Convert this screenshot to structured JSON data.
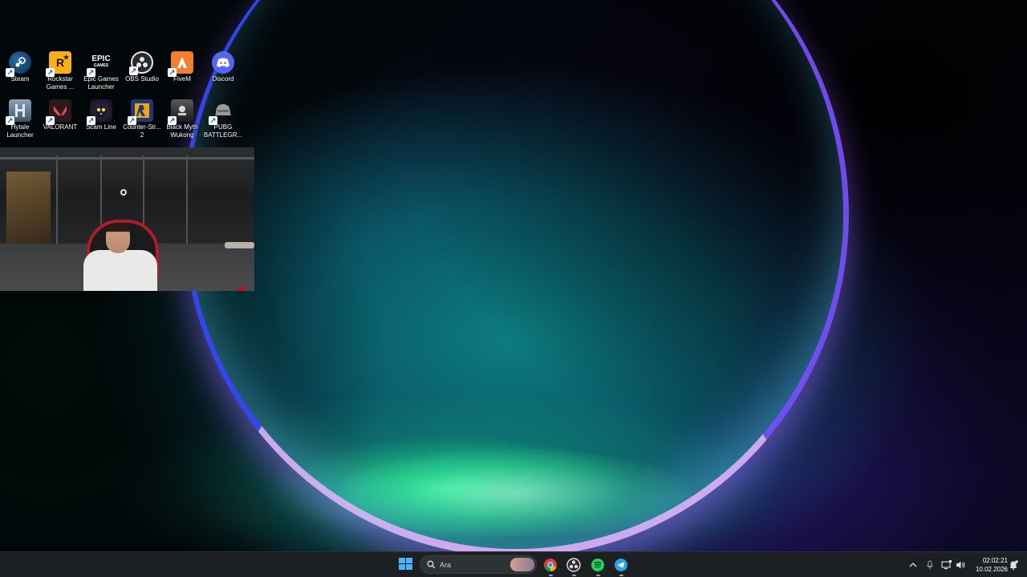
{
  "desktop": {
    "icons": [
      {
        "label": "Steam",
        "icon": "steam-icon"
      },
      {
        "label": "Rockstar\nGames ...",
        "icon": "rockstar-icon"
      },
      {
        "label": "Epic Games\nLauncher",
        "icon": "epic-games-icon"
      },
      {
        "label": "OBS Studio",
        "icon": "obs-icon"
      },
      {
        "label": "FiveM",
        "icon": "fivem-icon"
      },
      {
        "label": "Discord",
        "icon": "discord-icon"
      },
      {
        "label": "Hytale\nLauncher",
        "icon": "hytale-icon"
      },
      {
        "label": "VALORANT",
        "icon": "valorant-icon"
      },
      {
        "label": "Scam Line",
        "icon": "scam-line-icon"
      },
      {
        "label": "Counter-Str...\n2",
        "icon": "counter-strike-icon"
      },
      {
        "label": "Black Myth\nWukong",
        "icon": "black-myth-icon"
      },
      {
        "label": "PUBG\nBATTLEGR...",
        "icon": "pubg-icon"
      }
    ]
  },
  "webcam": {
    "label": "webcam-overlay"
  },
  "taskbar": {
    "search_placeholder": "Ara",
    "apps": [
      {
        "name": "Chrome",
        "icon": "chrome-icon"
      },
      {
        "name": "OBS Studio",
        "icon": "obs-icon"
      },
      {
        "name": "Spotify",
        "icon": "spotify-icon"
      },
      {
        "name": "Telegram",
        "icon": "telegram-icon"
      }
    ],
    "clock": {
      "time": "02:02:21",
      "date": "10.02.2026"
    }
  },
  "colors": {
    "taskbar_bg": "#1c2022",
    "start_blue": "#4fb3ff",
    "steam": "#1b3a5c",
    "rockstar": "#fcaf17",
    "fivem": "#f08030",
    "discord": "#5865f2",
    "valorant": "#e84a57",
    "spotify": "#1ed760",
    "telegram": "#2aa3df"
  }
}
